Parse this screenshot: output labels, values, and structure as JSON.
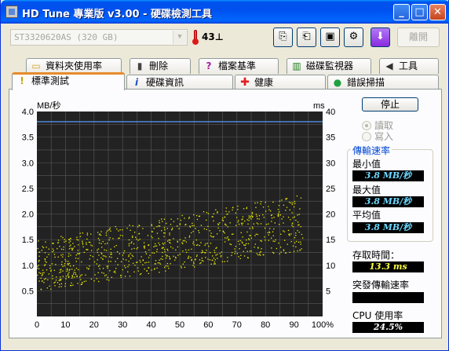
{
  "window": {
    "title": "HD Tune 專業版 v3.00 - 硬碟檢測工具",
    "minimize_glyph": "_",
    "maximize_glyph": "□",
    "close_glyph": "✕"
  },
  "toolbar": {
    "drive_value": "ST3320620AS  (320 GB)",
    "temperature": "43",
    "temperature_unit": "⊥",
    "exit_label": "離開",
    "buttons": [
      {
        "icon": "copy-text-icon",
        "glyph": "⎘"
      },
      {
        "icon": "copy-screenshot-icon",
        "glyph": "⎗"
      },
      {
        "icon": "save-icon",
        "glyph": "▣"
      },
      {
        "icon": "options-icon",
        "glyph": "⚙"
      },
      {
        "icon": "exit-arrow-icon",
        "glyph": "⬇"
      }
    ]
  },
  "tabs_top": [
    {
      "label": "資料夾使用率",
      "icon": "folder-icon",
      "glyph": "▭"
    },
    {
      "label": "刪除",
      "icon": "trash-icon",
      "glyph": "▮"
    },
    {
      "label": "檔案基準",
      "icon": "file-benchmark-icon",
      "glyph": "?"
    },
    {
      "label": "磁碟監視器",
      "icon": "disk-monitor-icon",
      "glyph": "▥"
    },
    {
      "label": "工具",
      "icon": "speaker-icon",
      "glyph": "◀"
    }
  ],
  "tabs_bottom": [
    {
      "label": "標準測試",
      "icon": "lightbulb-icon",
      "glyph": "!",
      "active": true
    },
    {
      "label": "硬碟資訊",
      "icon": "info-icon",
      "glyph": "i",
      "active": false
    },
    {
      "label": "健康",
      "icon": "health-cross-icon",
      "glyph": "✚",
      "active": false
    },
    {
      "label": "錯誤掃描",
      "icon": "magnifier-icon",
      "glyph": "●",
      "active": false
    }
  ],
  "controls": {
    "stop_label": "停止",
    "read_label": "讀取",
    "write_label": "寫入",
    "transfer_group_title": "傳輸速率",
    "min_label": "最小值",
    "min_value": "3.8 MB/秒",
    "max_label": "最大值",
    "max_value": "3.8 MB/秒",
    "avg_label": "平均值",
    "avg_value": "3.8 MB/秒",
    "access_label": "存取時間：",
    "access_value": "13.3 ms",
    "burst_label": "突發傳輸速率",
    "burst_value": "",
    "cpu_label": "CPU 使用率",
    "cpu_value": "24.5%"
  },
  "chart_data": {
    "type": "line",
    "left_unit": "MB/秒",
    "right_unit": "ms",
    "y_left_ticks": [
      "4.0",
      "3.5",
      "3.0",
      "2.5",
      "2.0",
      "1.5",
      "1.0",
      "0.5"
    ],
    "y_right_ticks": [
      "40",
      "35",
      "30",
      "25",
      "20",
      "15",
      "10",
      "5"
    ],
    "x_ticks": [
      "0",
      "10",
      "20",
      "30",
      "40",
      "50",
      "60",
      "70",
      "80",
      "90",
      "100%"
    ],
    "xlim": [
      0,
      100
    ],
    "ylim_left": [
      0,
      4.0
    ],
    "ylim_right": [
      0,
      40
    ],
    "grid": true,
    "colors": {
      "background": "#222222",
      "grid": "#5a5a5a",
      "transfer_line": "#4e88d8",
      "access_points": "#f0f000"
    },
    "series": [
      {
        "values_description": "transfer rate, MB/s",
        "x": [
          0,
          10,
          20,
          30,
          40,
          50,
          60,
          70,
          80,
          90,
          100
        ],
        "y": [
          3.8,
          3.8,
          3.8,
          3.8,
          3.8,
          3.8,
          3.8,
          3.8,
          3.8,
          3.8,
          3.8
        ]
      },
      {
        "values_description": "access time, ms",
        "x_range": [
          0,
          93
        ],
        "y_trend_start": [
          5,
          15
        ],
        "y_trend_end": [
          13,
          24
        ]
      }
    ]
  }
}
